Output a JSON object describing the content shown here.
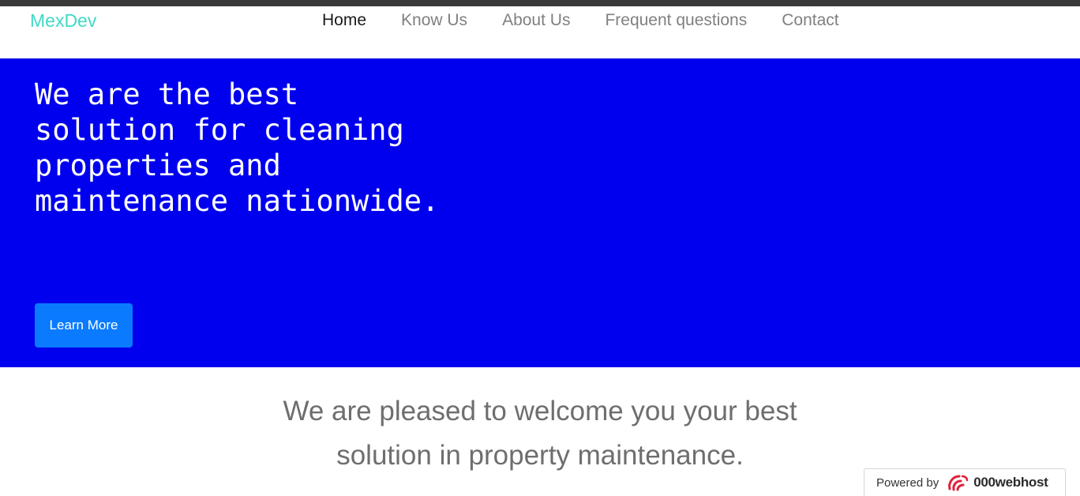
{
  "navbar": {
    "brand": "MexDev",
    "links": [
      {
        "label": "Home",
        "active": true
      },
      {
        "label": "Know Us",
        "active": false
      },
      {
        "label": "About Us",
        "active": false
      },
      {
        "label": "Frequent questions",
        "active": false
      },
      {
        "label": "Contact",
        "active": false
      }
    ]
  },
  "hero": {
    "title": "We are the best solution for cleaning properties and maintenance nationwide.",
    "button_label": "Learn More"
  },
  "welcome": {
    "line1": "We are pleased to welcome you your best",
    "line2": "solution in property maintenance."
  },
  "badge": {
    "label": "Powered by",
    "host": "000webhost",
    "icon": "000webhost-logo-icon"
  },
  "colors": {
    "brand": "#40d9c8",
    "hero_bg": "#0000ee",
    "button_bg": "#0a7bff",
    "badge_icon": "#e0203a"
  }
}
